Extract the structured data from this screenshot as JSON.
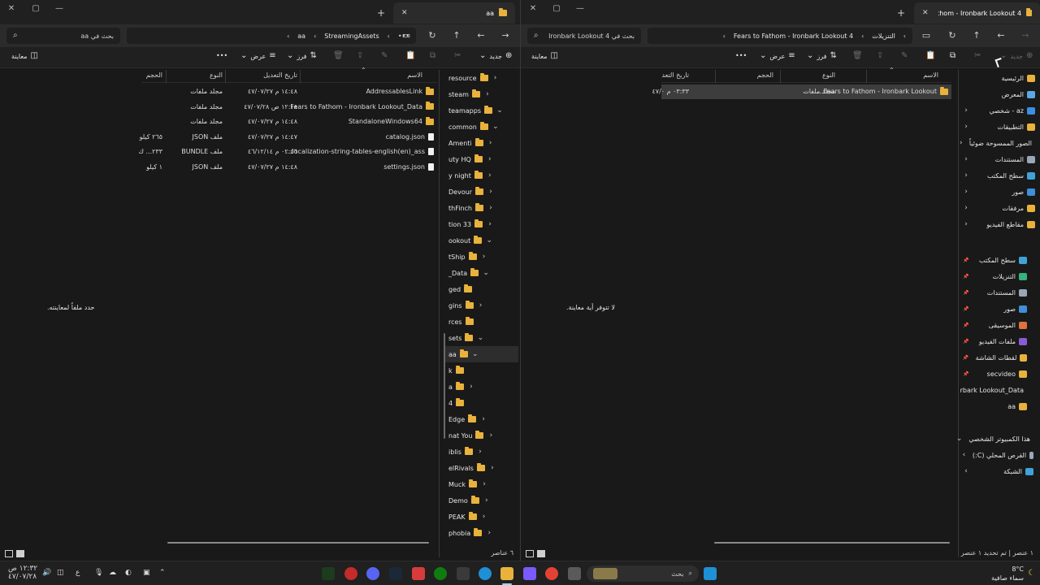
{
  "left": {
    "tab_title": "aa",
    "search_placeholder": "بحث في aa",
    "path": [
      "StreamingAssets",
      "aa"
    ],
    "cmd": {
      "new": "جديد",
      "sort": "فرز",
      "view": "عرض",
      "more": "•••",
      "preview": "معاينة"
    },
    "columns": {
      "name": "الاسم",
      "date": "تاريخ التعديل",
      "type": "النوع",
      "size": "الحجم"
    },
    "files": [
      {
        "name": "AddressablesLink",
        "date": "١٤:٤٨ م ٤٧/٠٧/٢٧",
        "type": "مجلد ملفات",
        "size": "",
        "kind": "folder"
      },
      {
        "name": "Fears to Fathom - Ironbark Lookout_Data",
        "date": "١٢:١٨ ص ٤٧/٠٧/٢٨",
        "type": "مجلد ملفات",
        "size": "",
        "kind": "folder"
      },
      {
        "name": "StandaloneWindows64",
        "date": "١٤:٤٨ م ٤٧/٠٧/٢٧",
        "type": "مجلد ملفات",
        "size": "",
        "kind": "folder"
      },
      {
        "name": "catalog.json",
        "date": "١٤:٤٧ م ٤٧/٠٧/٢٧",
        "type": "ملف JSON",
        "size": "٢٦٥ كيلو",
        "kind": "file"
      },
      {
        "name": "localization-string-tables-english(en)_ass...",
        "date": "٠٢:٥٦ م ٤٦/١٢/١٤",
        "type": "ملف BUNDLE",
        "size": "٢٣٣... ك",
        "kind": "file"
      },
      {
        "name": "settings.json",
        "date": "١٤:٤٨ م ٤٧/٠٧/٢٧",
        "type": "ملف JSON",
        "size": "١ كيلو",
        "kind": "file"
      }
    ],
    "nav": [
      {
        "label": "resource",
        "chev": "›"
      },
      {
        "label": "steam",
        "chev": "›"
      },
      {
        "label": "teamapps",
        "chev": "⌄"
      },
      {
        "label": "common",
        "chev": "⌄"
      },
      {
        "label": "Amenti",
        "chev": "›"
      },
      {
        "label": "uty HQ",
        "chev": "›"
      },
      {
        "label": "y night",
        "chev": "›"
      },
      {
        "label": "Devour",
        "chev": "›"
      },
      {
        "label": "thFinch",
        "chev": "›"
      },
      {
        "label": "tion 33",
        "chev": "›"
      },
      {
        "label": "ookout",
        "chev": "⌄"
      },
      {
        "label": "tShip",
        "chev": "›"
      },
      {
        "label": "_Data",
        "chev": "⌄"
      },
      {
        "label": "ged",
        "chev": ""
      },
      {
        "label": "gins",
        "chev": "›"
      },
      {
        "label": "rces",
        "chev": ""
      },
      {
        "label": "sets",
        "chev": "⌄"
      },
      {
        "label": "aa",
        "chev": "⌄"
      },
      {
        "label": "k",
        "chev": ""
      },
      {
        "label": "a",
        "chev": "›"
      },
      {
        "label": "4",
        "chev": ""
      },
      {
        "label": "Edge",
        "chev": "›"
      },
      {
        "label": "nat You",
        "chev": "›"
      },
      {
        "label": "iblis",
        "chev": "›"
      },
      {
        "label": "elRivals",
        "chev": "›"
      },
      {
        "label": "Muck",
        "chev": "›"
      },
      {
        "label": "Demo",
        "chev": "›"
      },
      {
        "label": "PEAK",
        "chev": "›"
      },
      {
        "label": "phobia",
        "chev": "›"
      }
    ],
    "preview_text": "حدد ملفاً لمعاينته.",
    "status": "٦ عناصر"
  },
  "right": {
    "tab_title": "Fears to Fathom - Ironbark Lookout 4",
    "search_placeholder": "بحث في Ironbark Lookout 4",
    "path": [
      "التنزيلات",
      "Fears to Fathom - Ironbark Lookout 4"
    ],
    "cmd": {
      "new": "جديد",
      "sort": "فرز",
      "view": "عرض",
      "more": "•••",
      "preview": "معاينة"
    },
    "columns": {
      "name": "الاسم",
      "type": "النوع",
      "size": "الحجم",
      "date": "تاريخ التعد"
    },
    "files": [
      {
        "name": "Fears to Fathom - Ironbark Lookout...",
        "type": "مجلد ملفات",
        "size": "",
        "date": "٠٣:٣٣ م ٤٧/٠"
      }
    ],
    "nav": [
      {
        "label": "الرئيسية",
        "icon": "home-icon",
        "color": "#e8b23c",
        "chev": ""
      },
      {
        "label": "المعرض",
        "icon": "gallery-icon",
        "color": "#5aa9e6",
        "chev": ""
      },
      {
        "label": "az - شخصي",
        "icon": "onedrive-icon",
        "color": "#3a8ee6",
        "chev": "›"
      },
      {
        "label": "التطبيقات",
        "icon": "folder-icon",
        "color": "#e8b23c",
        "chev": "›"
      },
      {
        "label": "الصور الممسوحة ضوئياً",
        "icon": "folder-icon",
        "color": "#e8b23c",
        "chev": "›"
      },
      {
        "label": "المستندات",
        "icon": "documents-icon",
        "color": "#9aa7b8",
        "chev": "›"
      },
      {
        "label": "سطح المكتب",
        "icon": "desktop-icon",
        "color": "#3fa3d9",
        "chev": "›"
      },
      {
        "label": "صور",
        "icon": "pictures-icon",
        "color": "#3f8fd9",
        "chev": "›"
      },
      {
        "label": "مرفقات",
        "icon": "folder-icon",
        "color": "#e8b23c",
        "chev": "›"
      },
      {
        "label": "مقاطع الفيديو",
        "icon": "folder-icon",
        "color": "#e8b23c",
        "chev": "›"
      }
    ],
    "quick": [
      {
        "label": "سطح المكتب",
        "icon": "desktop-icon",
        "color": "#3fa3d9"
      },
      {
        "label": "التنزيلات",
        "icon": "download-icon",
        "color": "#36b37e"
      },
      {
        "label": "المستندات",
        "icon": "documents-icon",
        "color": "#9aa7b8"
      },
      {
        "label": "صور",
        "icon": "pictures-icon",
        "color": "#3f8fd9"
      },
      {
        "label": "الموسيقى",
        "icon": "music-icon",
        "color": "#e0703c"
      },
      {
        "label": "ملفات الفيديو",
        "icon": "videos-icon",
        "color": "#8a5ad9"
      },
      {
        "label": "لقطات الشاشة",
        "icon": "folder-icon",
        "color": "#e8b23c"
      },
      {
        "label": "secvideo",
        "icon": "folder-icon",
        "color": "#e8b23c"
      },
      {
        "label": "rbark Lookout_Data",
        "icon": "folder-icon",
        "color": "#e8b23c"
      },
      {
        "label": "aa",
        "icon": "folder-icon",
        "color": "#e8b23c"
      }
    ],
    "computer": [
      {
        "label": "هذا الكمبيوتر الشخصي",
        "icon": "pc-icon",
        "color": "#3fa3d9",
        "chev": "⌄"
      },
      {
        "label": "القرص المحلي (C:)",
        "icon": "drive-icon",
        "color": "#9aa7b8",
        "chev": "›"
      },
      {
        "label": "الشبكة",
        "icon": "network-icon",
        "color": "#3fa3d9",
        "chev": "›"
      }
    ],
    "preview_text": "لا تتوفر أية معاينة.",
    "status": "١ عنصر  |  تم تحديد ١ عنصر"
  },
  "taskbar": {
    "weather_temp": "8°C",
    "weather_desc": "سماء صافية",
    "search_placeholder": "بحث",
    "clock_time": "١٢:٣٢ ص",
    "clock_date": "٤٧/٠٧/٢٨",
    "lang": "ع"
  }
}
